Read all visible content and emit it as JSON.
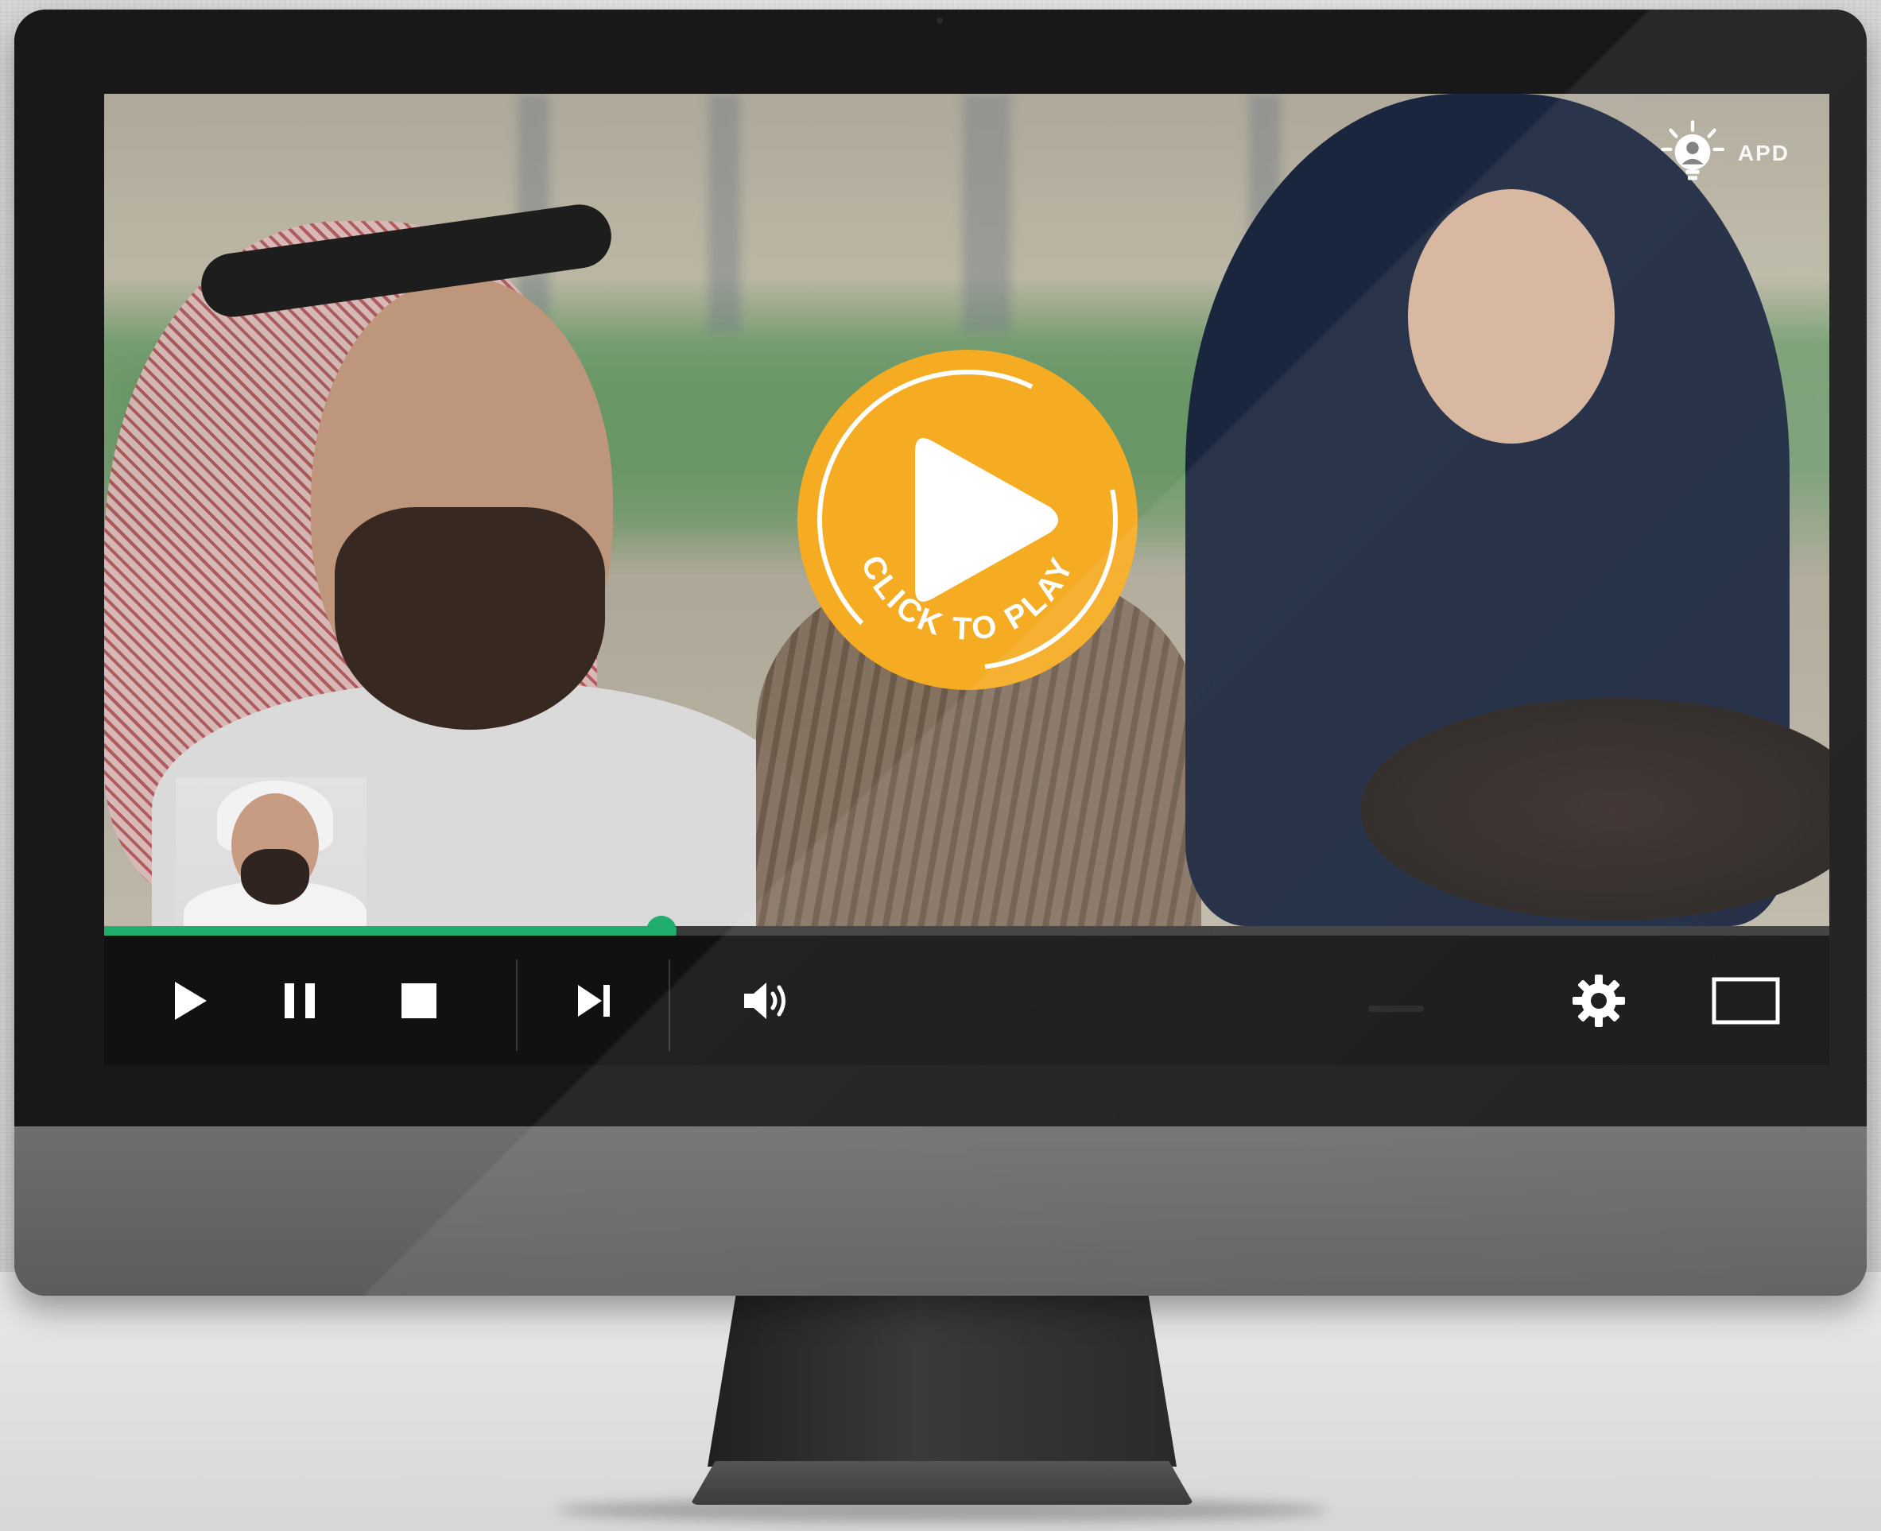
{
  "player": {
    "overlay_label": "CLICK TO PLAY",
    "progress_fraction": 0.323,
    "brand_color": "#f5ab22",
    "accent_color": "#1fae6c"
  },
  "logo": {
    "mark": "APD",
    "icon": "lightbulb-person-icon"
  },
  "controls": {
    "play": "play-icon",
    "pause": "pause-icon",
    "stop": "stop-icon",
    "next": "skip-next-icon",
    "volume": "volume-icon",
    "settings": "gear-icon",
    "fullscreen": "fullscreen-icon"
  }
}
